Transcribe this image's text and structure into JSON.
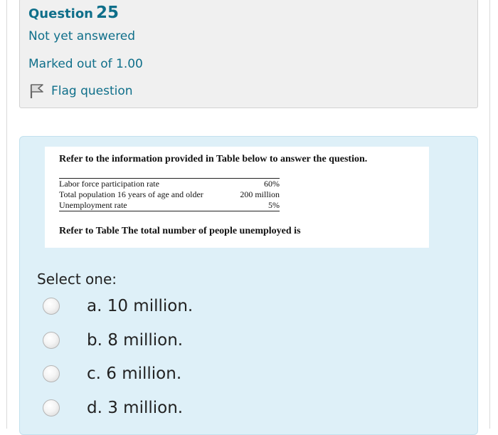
{
  "info": {
    "question_word": "Question",
    "question_number": "25",
    "state": "Not yet answered",
    "grade": "Marked out of 1.00",
    "flag_label": "Flag question"
  },
  "question_image": {
    "intro": "Refer to the information provided in Table below to answer the question.",
    "table": [
      {
        "label": "Labor force participation rate",
        "value": "60%"
      },
      {
        "label": "Total population 16 years of age and older",
        "value": "200 million"
      },
      {
        "label": "Unemployment rate",
        "value": "5%"
      }
    ],
    "question": "Refer to Table The total number of people unemployed is"
  },
  "prompt": "Select one:",
  "answers": [
    {
      "label": "a. 10 million."
    },
    {
      "label": "b. 8 million."
    },
    {
      "label": "c. 6 million."
    },
    {
      "label": "d. 3 million."
    }
  ],
  "colors": {
    "link": "#0f6f8a",
    "info_bg": "#f0f0f0",
    "content_bg": "#def0f8"
  },
  "icons": {
    "flag": "flag-icon"
  }
}
